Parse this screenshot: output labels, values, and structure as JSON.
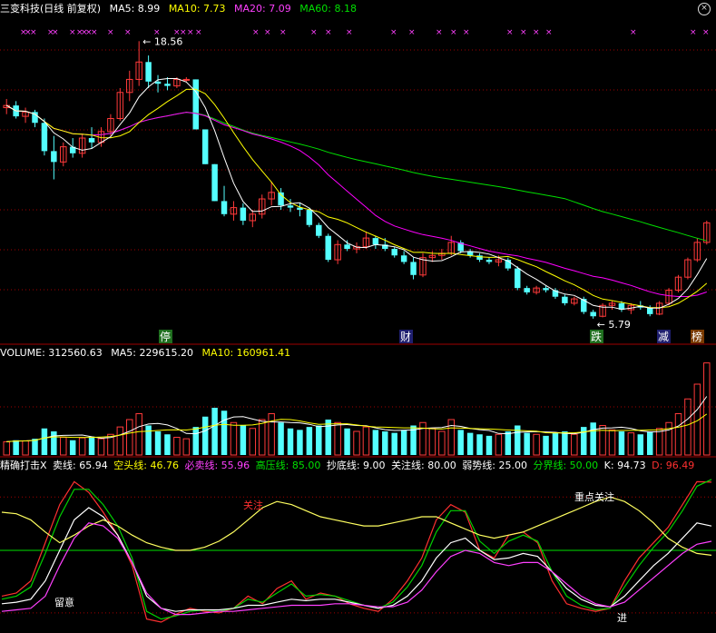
{
  "header_main": {
    "title": "三变科技(日线 前复权)",
    "ma5": "MA5: 8.99",
    "ma10": "MA10: 7.73",
    "ma20": "MA20: 7.09",
    "ma60": "MA60: 8.18",
    "close_icon": "close-x-icon"
  },
  "header_volume": {
    "volume": "VOLUME: 312560.63",
    "ma5": "MA5: 229615.20",
    "ma10": "MA10: 160961.41"
  },
  "header_indicator": {
    "name": "精确打击X",
    "sell": "卖线: 65.94",
    "short": "空头线: 46.76",
    "must_sell": "必卖线: 55.96",
    "high": "高压线: 85.00",
    "bottom": "抄底线: 9.00",
    "watch": "关注线: 80.00",
    "weak": "弱势线: 25.00",
    "boundary": "分界线: 50.00",
    "k": "K: 94.73",
    "d": "D: 96.49"
  },
  "colors": {
    "up": "#ff3a3a",
    "down": "#54ffff",
    "ma5": "#ffffff",
    "ma10": "#ffff00",
    "ma20": "#ff00ff",
    "ma60": "#00e000",
    "grid": "#a00000",
    "marker": "#ff40ff"
  },
  "chart_data": [
    {
      "type": "candlestick",
      "title": "三变科技(日线 前复权)",
      "price_range": [
        5.2,
        19.2
      ],
      "annotations": [
        {
          "label": "18.56",
          "value": 18.56,
          "kind": "high"
        },
        {
          "label": "5.79",
          "value": 5.79,
          "kind": "low"
        }
      ],
      "bottom_tags": [
        "停",
        "财",
        "跌",
        "减",
        "榜"
      ],
      "top_marker": "×",
      "candles": [
        [
          15.5,
          15.9,
          15.2,
          15.6
        ],
        [
          15.6,
          15.8,
          15.0,
          15.1
        ],
        [
          15.1,
          15.5,
          14.8,
          15.3
        ],
        [
          15.3,
          15.4,
          14.6,
          14.8
        ],
        [
          14.8,
          15.0,
          13.3,
          13.5
        ],
        [
          13.5,
          14.2,
          12.2,
          13.0
        ],
        [
          13.0,
          13.9,
          12.8,
          13.7
        ],
        [
          13.7,
          14.1,
          13.2,
          13.4
        ],
        [
          13.4,
          14.3,
          13.2,
          14.1
        ],
        [
          14.1,
          14.6,
          13.6,
          13.9
        ],
        [
          13.9,
          14.6,
          13.7,
          14.4
        ],
        [
          14.4,
          15.2,
          14.2,
          15.0
        ],
        [
          15.0,
          16.4,
          14.9,
          16.2
        ],
        [
          16.2,
          17.2,
          15.8,
          16.8
        ],
        [
          16.8,
          18.56,
          16.5,
          17.6
        ],
        [
          17.6,
          17.9,
          16.4,
          16.7
        ],
        [
          16.7,
          17.0,
          16.2,
          16.6
        ],
        [
          16.6,
          16.9,
          16.3,
          16.5
        ],
        [
          16.5,
          16.9,
          16.4,
          16.8
        ],
        [
          16.8,
          16.9,
          16.7,
          16.8
        ],
        [
          16.8,
          16.8,
          14.5,
          14.5
        ],
        [
          14.5,
          14.5,
          12.9,
          12.9
        ],
        [
          12.9,
          12.9,
          11.2,
          11.2
        ],
        [
          11.2,
          11.9,
          10.5,
          10.6
        ],
        [
          10.6,
          11.2,
          10.3,
          10.9
        ],
        [
          10.9,
          11.1,
          10.1,
          10.3
        ],
        [
          10.3,
          10.8,
          10.0,
          10.6
        ],
        [
          10.6,
          11.5,
          10.4,
          11.3
        ],
        [
          11.3,
          12.1,
          11.0,
          11.6
        ],
        [
          11.6,
          11.8,
          10.8,
          11.0
        ],
        [
          11.0,
          11.3,
          10.7,
          10.9
        ],
        [
          10.9,
          11.1,
          10.5,
          10.8
        ],
        [
          10.8,
          10.9,
          10.0,
          10.1
        ],
        [
          10.1,
          10.2,
          9.5,
          9.6
        ],
        [
          9.6,
          9.7,
          8.4,
          8.5
        ],
        [
          8.5,
          9.4,
          8.3,
          9.2
        ],
        [
          9.2,
          9.4,
          8.9,
          9.0
        ],
        [
          9.0,
          9.3,
          8.8,
          9.1
        ],
        [
          9.1,
          9.8,
          9.0,
          9.5
        ],
        [
          9.5,
          9.6,
          9.0,
          9.2
        ],
        [
          9.2,
          9.5,
          8.9,
          9.0
        ],
        [
          9.0,
          9.1,
          8.6,
          8.7
        ],
        [
          8.7,
          8.9,
          8.3,
          8.4
        ],
        [
          8.4,
          8.6,
          7.6,
          7.8
        ],
        [
          7.8,
          8.8,
          7.7,
          8.6
        ],
        [
          8.6,
          8.9,
          8.4,
          8.7
        ],
        [
          8.7,
          9.0,
          8.5,
          8.8
        ],
        [
          8.8,
          9.6,
          8.7,
          9.3
        ],
        [
          9.3,
          9.4,
          8.8,
          8.9
        ],
        [
          8.9,
          9.0,
          8.6,
          8.7
        ],
        [
          8.7,
          8.8,
          8.4,
          8.5
        ],
        [
          8.5,
          8.6,
          8.3,
          8.4
        ],
        [
          8.4,
          8.7,
          8.2,
          8.5
        ],
        [
          8.5,
          8.6,
          8.0,
          8.1
        ],
        [
          8.1,
          8.2,
          7.1,
          7.2
        ],
        [
          7.2,
          7.3,
          6.9,
          7.0
        ],
        [
          7.0,
          7.3,
          6.9,
          7.2
        ],
        [
          7.2,
          7.3,
          7.0,
          7.1
        ],
        [
          7.1,
          7.2,
          6.7,
          6.8
        ],
        [
          6.8,
          6.9,
          6.4,
          6.5
        ],
        [
          6.5,
          6.8,
          6.4,
          6.7
        ],
        [
          6.7,
          6.8,
          6.0,
          6.1
        ],
        [
          6.1,
          6.2,
          5.79,
          5.9
        ],
        [
          5.9,
          6.5,
          5.85,
          6.4
        ],
        [
          6.4,
          6.6,
          6.2,
          6.5
        ],
        [
          6.5,
          6.6,
          6.1,
          6.2
        ],
        [
          6.2,
          6.5,
          6.0,
          6.4
        ],
        [
          6.4,
          6.6,
          6.2,
          6.3
        ],
        [
          6.3,
          6.4,
          5.9,
          6.0
        ],
        [
          6.0,
          6.6,
          5.95,
          6.5
        ],
        [
          6.5,
          7.2,
          6.4,
          7.1
        ],
        [
          7.1,
          7.8,
          7.0,
          7.7
        ],
        [
          7.7,
          8.6,
          7.6,
          8.5
        ],
        [
          8.5,
          9.5,
          8.4,
          9.3
        ],
        [
          9.3,
          10.3,
          9.2,
          10.2
        ]
      ]
    },
    {
      "type": "bar",
      "title": "VOLUME",
      "max": 320000,
      "values": [
        45,
        50,
        48,
        55,
        90,
        80,
        60,
        50,
        58,
        62,
        55,
        70,
        95,
        120,
        140,
        100,
        80,
        70,
        60,
        55,
        95,
        130,
        160,
        150,
        110,
        100,
        90,
        120,
        140,
        110,
        90,
        85,
        95,
        100,
        120,
        110,
        90,
        80,
        95,
        85,
        80,
        75,
        85,
        100,
        110,
        90,
        80,
        120,
        85,
        75,
        70,
        65,
        70,
        80,
        100,
        75,
        70,
        65,
        75,
        80,
        70,
        95,
        110,
        100,
        85,
        80,
        75,
        70,
        80,
        90,
        110,
        140,
        190,
        240,
        312
      ]
    },
    {
      "type": "line",
      "title": "精确打击X",
      "ylim": [
        0,
        100
      ],
      "reference_lines": [
        {
          "name": "分界线",
          "value": 50,
          "color": "#00e000"
        },
        {
          "name": "高压线",
          "value": 85,
          "color": "#a00000"
        },
        {
          "name": "抄底线",
          "value": 9,
          "color": "#a00000"
        }
      ],
      "series": [
        {
          "name": "K",
          "color": "#ff3030",
          "values": [
            20,
            22,
            30,
            55,
            80,
            95,
            88,
            75,
            60,
            40,
            5,
            3,
            8,
            12,
            10,
            9,
            12,
            20,
            15,
            25,
            30,
            18,
            22,
            20,
            15,
            12,
            10,
            18,
            30,
            45,
            70,
            80,
            75,
            50,
            45,
            60,
            62,
            55,
            30,
            15,
            12,
            10,
            12,
            30,
            45,
            55,
            65,
            80,
            95,
            94.73
          ]
        },
        {
          "name": "D",
          "color": "#00d000",
          "values": [
            18,
            20,
            26,
            48,
            72,
            90,
            90,
            80,
            66,
            45,
            10,
            5,
            7,
            10,
            11,
            10,
            12,
            18,
            16,
            22,
            28,
            20,
            21,
            20,
            17,
            14,
            12,
            16,
            26,
            40,
            62,
            76,
            76,
            56,
            48,
            56,
            60,
            56,
            36,
            20,
            14,
            11,
            12,
            26,
            40,
            52,
            62,
            76,
            92,
            96.49
          ]
        },
        {
          "name": "卖线",
          "color": "#ffffff",
          "values": [
            15,
            16,
            18,
            30,
            50,
            70,
            78,
            72,
            60,
            42,
            20,
            12,
            10,
            11,
            11,
            11,
            12,
            14,
            14,
            16,
            18,
            17,
            18,
            18,
            16,
            14,
            12,
            14,
            20,
            30,
            45,
            55,
            58,
            50,
            44,
            45,
            48,
            46,
            36,
            25,
            18,
            14,
            13,
            20,
            30,
            40,
            48,
            58,
            68,
            65.94
          ]
        },
        {
          "name": "空头线",
          "color": "#ffff60",
          "values": [
            75,
            74,
            70,
            62,
            55,
            60,
            66,
            70,
            66,
            60,
            55,
            52,
            50,
            50,
            52,
            56,
            62,
            70,
            78,
            82,
            80,
            76,
            72,
            70,
            68,
            66,
            66,
            68,
            70,
            72,
            72,
            68,
            64,
            60,
            58,
            60,
            62,
            66,
            70,
            74,
            78,
            82,
            85,
            82,
            76,
            68,
            58,
            52,
            48,
            46.76
          ]
        },
        {
          "name": "必卖线",
          "color": "#ff40ff",
          "values": [
            10,
            11,
            12,
            20,
            40,
            58,
            68,
            66,
            58,
            42,
            22,
            12,
            8,
            8,
            9,
            10,
            10,
            11,
            12,
            13,
            14,
            14,
            14,
            15,
            15,
            14,
            13,
            13,
            16,
            24,
            36,
            46,
            50,
            48,
            42,
            40,
            42,
            42,
            36,
            28,
            20,
            15,
            13,
            16,
            24,
            32,
            40,
            48,
            54,
            55.96
          ]
        }
      ],
      "annotations": [
        "留意",
        "关注",
        "重点关注",
        "进"
      ]
    }
  ]
}
